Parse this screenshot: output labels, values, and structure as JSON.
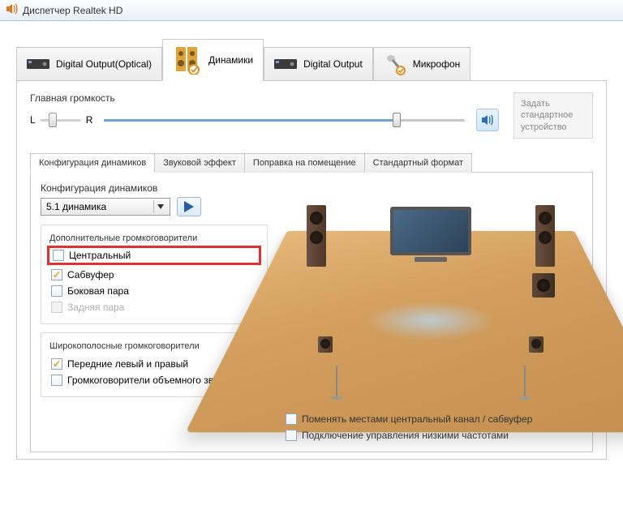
{
  "window": {
    "title": "Диспетчер Realtek HD"
  },
  "tabs_main": [
    {
      "id": "digital-optical",
      "label": "Digital Output(Optical)"
    },
    {
      "id": "speakers",
      "label": "Динамики",
      "active": true
    },
    {
      "id": "digital",
      "label": "Digital Output"
    },
    {
      "id": "mic",
      "label": "Микрофон"
    }
  ],
  "volume": {
    "title": "Главная громкость",
    "balance_left": "L",
    "balance_right": "R"
  },
  "default_device_label": "Задать стандартное устройство",
  "subtabs": [
    {
      "id": "config",
      "label": "Конфигурация динамиков",
      "active": true
    },
    {
      "id": "effects",
      "label": "Звуковой эффект"
    },
    {
      "id": "room",
      "label": "Поправка на помещение"
    },
    {
      "id": "format",
      "label": "Стандартный формат"
    }
  ],
  "config": {
    "label": "Конфигурация динамиков",
    "selected": "5.1 динамика"
  },
  "opt_speakers": {
    "title": "Дополнительные громкоговорители",
    "items": [
      {
        "key": "center",
        "label": "Центральный",
        "checked": false,
        "disabled": false,
        "highlight": true
      },
      {
        "key": "sub",
        "label": "Сабвуфер",
        "checked": true,
        "disabled": false
      },
      {
        "key": "side",
        "label": "Боковая пара",
        "checked": false,
        "disabled": false
      },
      {
        "key": "rear",
        "label": "Задняя пара",
        "checked": false,
        "disabled": true
      }
    ]
  },
  "fullrange": {
    "title": "Широкополосные громкоговорители",
    "items": [
      {
        "key": "front",
        "label": "Передние левый и правый",
        "checked": true
      },
      {
        "key": "surround",
        "label": "Громкоговорители объемного звука",
        "checked": false
      }
    ]
  },
  "bottom": {
    "swap": "Поменять местами центральный канал / сабвуфер",
    "bass": "Подключение управления низкими частотами"
  }
}
